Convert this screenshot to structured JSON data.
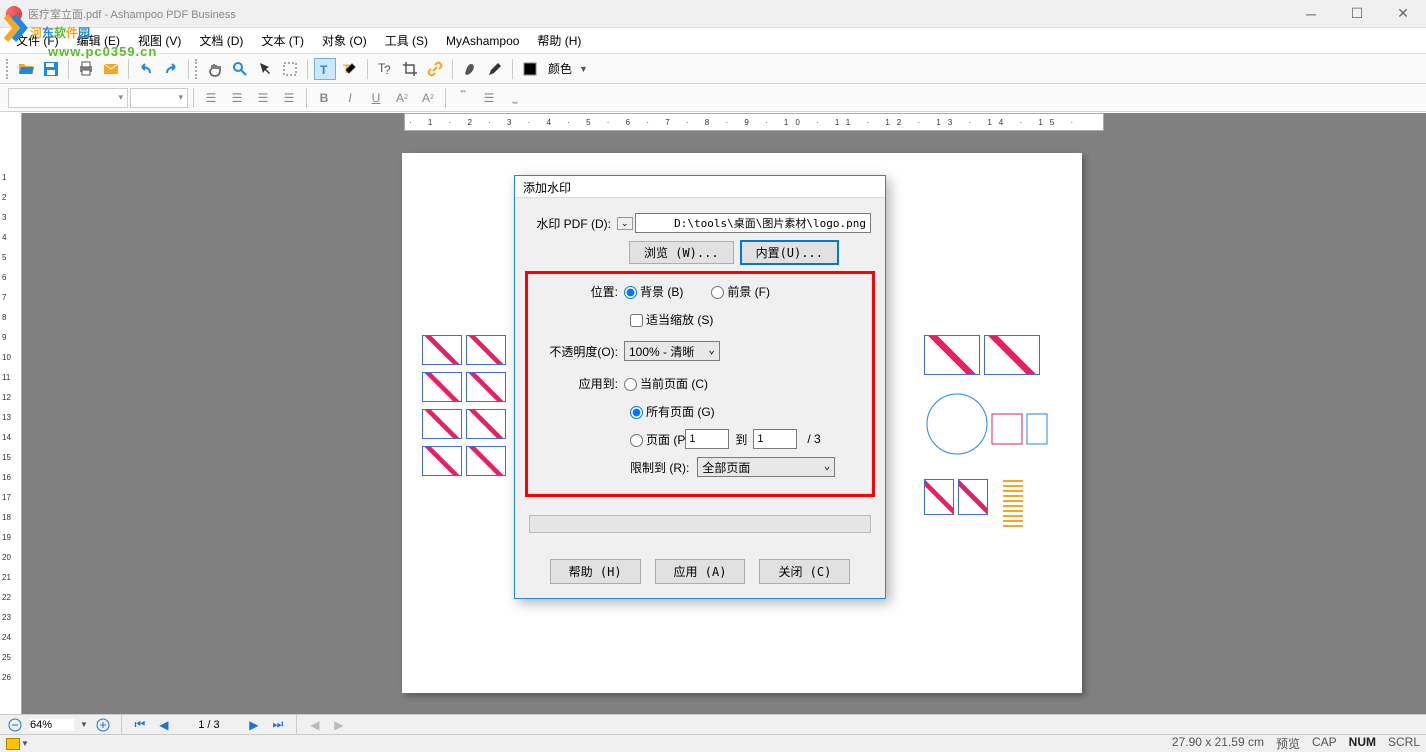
{
  "title": "医疗室立面.pdf - Ashampoo PDF Business",
  "menu": {
    "file": "文件 (F)",
    "edit": "编辑 (E)",
    "view": "视图 (V)",
    "document": "文档 (D)",
    "text": "文本 (T)",
    "object": "对象 (O)",
    "tools": "工具 (S)",
    "myashampoo": "MyAshampoo",
    "help": "帮助 (H)"
  },
  "color_label": "颜色",
  "dialog": {
    "title": "添加水印",
    "pdf_label": "水印 PDF (D):",
    "pdf_path": "D:\\tools\\桌面\\图片素材\\logo.png",
    "browse": "浏览 (W)...",
    "builtin": "内置(U)...",
    "position_label": "位置:",
    "bg": "背景 (B)",
    "fg": "前景 (F)",
    "fit_scale": "适当缩放 (S)",
    "opacity_label": "不透明度(O):",
    "opacity_value": "100% - 清晰",
    "apply_to_label": "应用到:",
    "current_page": "当前页面 (C)",
    "all_pages": "所有页面 (G)",
    "pages_radio": "页面 (P",
    "page_from": "1",
    "to_label": "到",
    "page_to": "1",
    "total": "/  3",
    "limit_label": "限制到 (R):",
    "limit_value": "全部页面",
    "help_btn": "帮助 (H)",
    "apply_btn": "应用 (A)",
    "close_btn": "关闭 (C)"
  },
  "nav": {
    "zoom": "64%",
    "page": "1 / 3"
  },
  "status": {
    "coords": "27.90 x 21.59 cm",
    "preview": "预览",
    "cap": "CAP",
    "num": "NUM",
    "scrl": "SCRL"
  },
  "watermark": {
    "text": "河东软件园",
    "url": "www.pc0359.cn"
  },
  "ruler": "1 2 3 4 5 6 7 8 9 10 11 12 13 14 15 16 17 18 19 20 21 22 23 24 25 26 27"
}
